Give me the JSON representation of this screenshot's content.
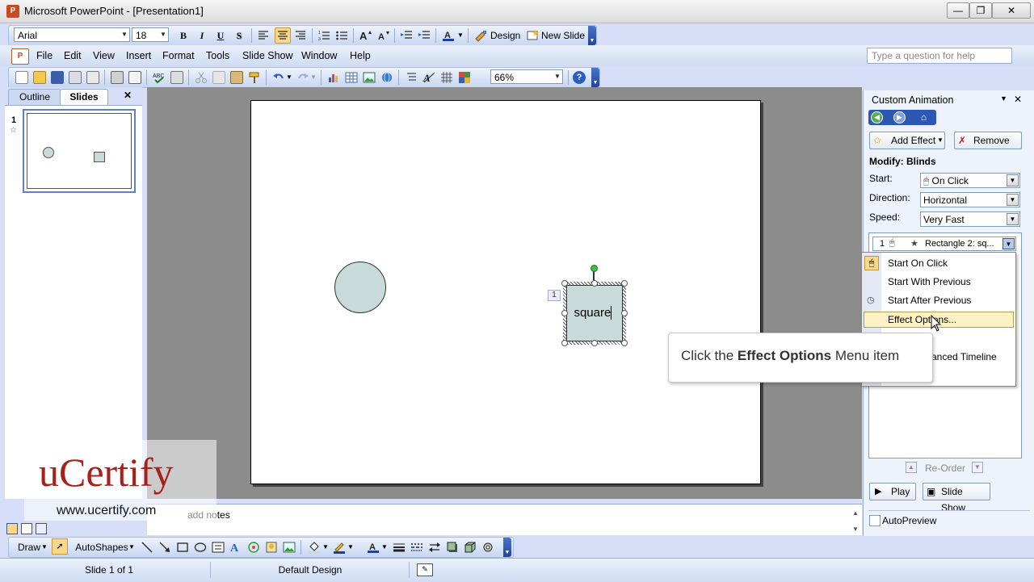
{
  "window": {
    "title": "Microsoft PowerPoint - [Presentation1]",
    "minimize": "—",
    "maximize": "❐",
    "close": "✕"
  },
  "formatting_toolbar": {
    "font_name": "Arial",
    "font_size": "18",
    "bold": "B",
    "italic": "I",
    "underline": "U",
    "shadow": "S",
    "design_label": "Design",
    "new_slide_label": "New Slide"
  },
  "menu": {
    "items": [
      "File",
      "Edit",
      "View",
      "Insert",
      "Format",
      "Tools",
      "Slide Show",
      "Window",
      "Help"
    ],
    "help_placeholder": "Type a question for help"
  },
  "standard_toolbar": {
    "zoom": "66%"
  },
  "left_pane": {
    "tabs": [
      "Outline",
      "Slides"
    ],
    "active_tab": "Slides",
    "close": "✕",
    "slide_number": "1",
    "slide_star": "☆"
  },
  "slide": {
    "shape_text": "square",
    "animation_tag": "1"
  },
  "notes": {
    "placeholder": "add notes"
  },
  "watermark": {
    "brand": "uCertify",
    "url": "www.ucertify.com"
  },
  "task_pane": {
    "title": "Custom Animation",
    "add_effect": "Add Effect",
    "remove": "Remove",
    "modify_heading": "Modify: Blinds",
    "start_label": "Start:",
    "start_value": "On Click",
    "direction_label": "Direction:",
    "direction_value": "Horizontal",
    "speed_label": "Speed:",
    "speed_value": "Very Fast",
    "list_item_number": "1",
    "list_item_text": "Rectangle 2: sq...",
    "reorder": "Re-Order",
    "play": "Play",
    "slide_show": "Slide Show",
    "autopreview": "AutoPreview"
  },
  "context_menu": {
    "items": [
      "Start On Click",
      "Start With Previous",
      "Start After Previous",
      "Effect Options...",
      "anced Timeline"
    ],
    "highlighted": "Effect Options..."
  },
  "callout": {
    "prefix": "Click the ",
    "bold": "Effect Options",
    "suffix": " Menu item"
  },
  "drawing_toolbar": {
    "draw": "Draw",
    "autoshapes": "AutoShapes"
  },
  "status": {
    "slide_count": "Slide 1 of 1",
    "design": "Default Design"
  },
  "colors": {
    "shape_fill": "#c9dada",
    "highlight": "#fdf2c3",
    "highlight_border": "#b59f4a",
    "canvas_bg": "#8c8c8c"
  }
}
